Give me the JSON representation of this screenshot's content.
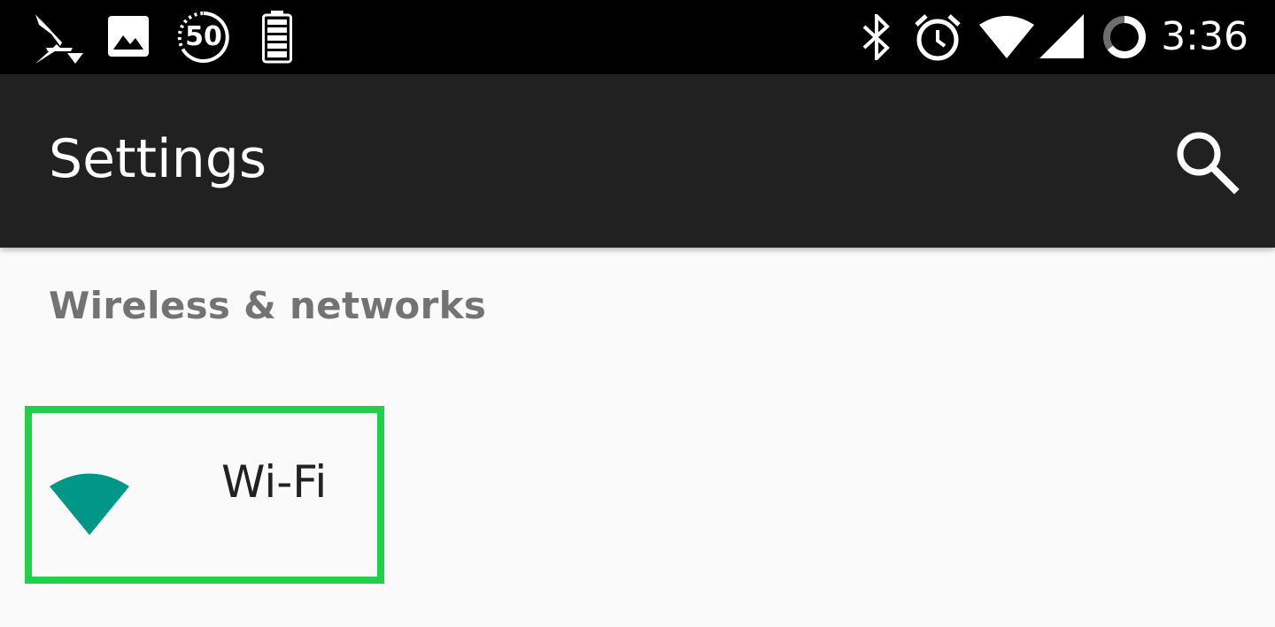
{
  "status_bar": {
    "time": "3:36",
    "network_speed_badge": "50",
    "icons": {
      "carrier": "sprint-logo-icon",
      "notification": "image-icon",
      "speed": "speed-badge-icon",
      "battery": "battery-full-icon",
      "bluetooth": "bluetooth-icon",
      "alarm": "alarm-clock-icon",
      "wifi": "wifi-signal-icon",
      "cellular": "cellular-signal-icon",
      "data_saver": "data-saver-icon"
    }
  },
  "toolbar": {
    "title": "Settings",
    "search_icon": "search-icon"
  },
  "sections": [
    {
      "header": "Wireless & networks",
      "items": [
        {
          "label": "Wi-Fi",
          "icon": "wifi-icon",
          "icon_color": "#009688",
          "highlight_color": "#1ed04a"
        }
      ]
    }
  ],
  "colors": {
    "status_bar_bg": "#000000",
    "toolbar_bg": "#212121",
    "content_bg": "#fafafa",
    "section_header": "#737373",
    "item_text": "#212121",
    "accent": "#009688"
  }
}
